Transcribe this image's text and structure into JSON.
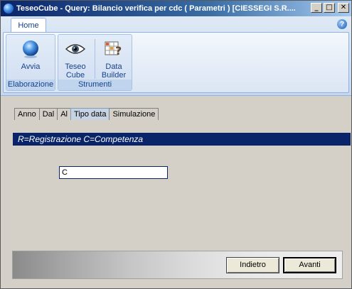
{
  "window": {
    "title": "TeseoCube - Query: Bilancio verifica per cdc ( Parametri ) [CIESSEGI S.R....",
    "controls": {
      "minimize": "_",
      "maximize": "□",
      "close": "✕"
    }
  },
  "ribbon": {
    "tab_label": "Home",
    "help_glyph": "?",
    "groups": [
      {
        "label": "Elaborazione",
        "buttons": [
          {
            "label": "Avvia",
            "icon": "globe-icon"
          }
        ]
      },
      {
        "label": "Strumenti",
        "buttons": [
          {
            "label_line1": "Teseo",
            "label_line2": "Cube",
            "icon": "eye-icon"
          },
          {
            "label_line1": "Data",
            "label_line2": "Builder",
            "icon": "grid-help-icon"
          }
        ]
      }
    ]
  },
  "tabs": [
    "Anno",
    "Dal",
    "Al",
    "Tipo data",
    "Simulazione"
  ],
  "active_tab": "Tipo data",
  "banner": "R=Registrazione  C=Competenza",
  "input": {
    "value": "C"
  },
  "buttons": {
    "back": "Indietro",
    "next": "Avanti"
  },
  "colors": {
    "banner_bg": "#0a246a",
    "title_bar": "#0a246a",
    "ribbon_text": "#15428b"
  }
}
